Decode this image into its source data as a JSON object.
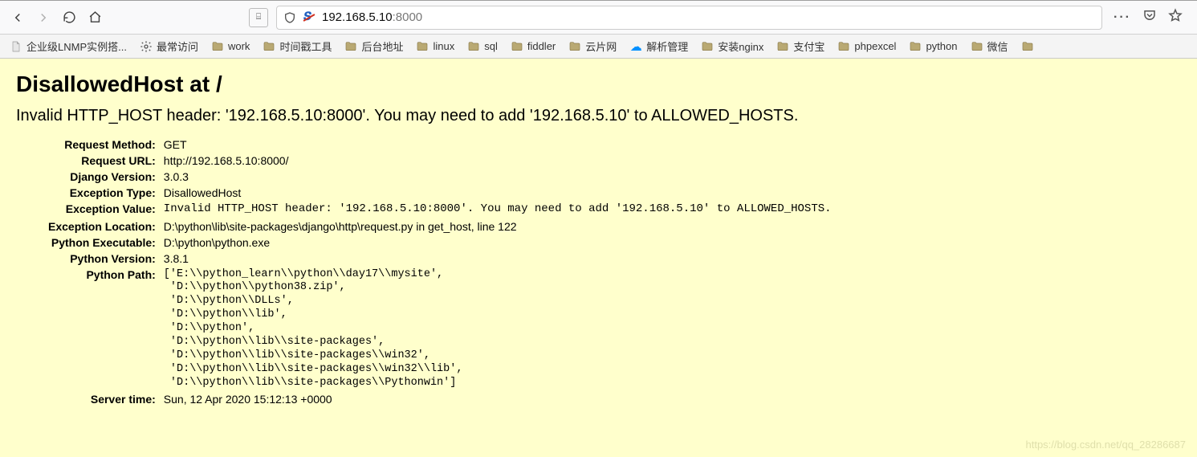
{
  "browser": {
    "url_host": "192.168.5.10",
    "url_port": ":8000"
  },
  "bookmarks": [
    {
      "type": "page",
      "label": "企业级LNMP实例搭...",
      "name": "bm-lnmp"
    },
    {
      "type": "gear",
      "label": "最常访问",
      "name": "bm-most-visited"
    },
    {
      "type": "folder",
      "label": "work",
      "name": "bm-work"
    },
    {
      "type": "folder",
      "label": "时间戳工具",
      "name": "bm-timestamp"
    },
    {
      "type": "folder",
      "label": "后台地址",
      "name": "bm-admin"
    },
    {
      "type": "folder",
      "label": "linux",
      "name": "bm-linux"
    },
    {
      "type": "folder",
      "label": "sql",
      "name": "bm-sql"
    },
    {
      "type": "folder",
      "label": "fiddler",
      "name": "bm-fiddler"
    },
    {
      "type": "folder",
      "label": "云片网",
      "name": "bm-yunpian"
    },
    {
      "type": "cloud",
      "label": "解析管理",
      "name": "bm-dns"
    },
    {
      "type": "folder",
      "label": "安装nginx",
      "name": "bm-nginx"
    },
    {
      "type": "folder",
      "label": "支付宝",
      "name": "bm-alipay"
    },
    {
      "type": "folder",
      "label": "phpexcel",
      "name": "bm-phpexcel"
    },
    {
      "type": "folder",
      "label": "python",
      "name": "bm-python"
    },
    {
      "type": "folder",
      "label": "微信",
      "name": "bm-wechat"
    },
    {
      "type": "folder",
      "label": "",
      "name": "bm-overflow"
    }
  ],
  "error": {
    "title": "DisallowedHost at /",
    "message": "Invalid HTTP_HOST header: '192.168.5.10:8000'. You may need to add '192.168.5.10' to ALLOWED_HOSTS.",
    "labels": {
      "request_method": "Request Method:",
      "request_url": "Request URL:",
      "django_version": "Django Version:",
      "exception_type": "Exception Type:",
      "exception_value": "Exception Value:",
      "exception_location": "Exception Location:",
      "python_executable": "Python Executable:",
      "python_version": "Python Version:",
      "python_path": "Python Path:",
      "server_time": "Server time:"
    },
    "request_method": "GET",
    "request_url": "http://192.168.5.10:8000/",
    "django_version": "3.0.3",
    "exception_type": "DisallowedHost",
    "exception_value": "Invalid HTTP_HOST header: '192.168.5.10:8000'. You may need to add '192.168.5.10' to ALLOWED_HOSTS.",
    "exception_location": "D:\\python\\lib\\site-packages\\django\\http\\request.py in get_host, line 122",
    "python_executable": "D:\\python\\python.exe",
    "python_version": "3.8.1",
    "python_path": "['E:\\\\python_learn\\\\python\\\\day17\\\\mysite',\n 'D:\\\\python\\\\python38.zip',\n 'D:\\\\python\\\\DLLs',\n 'D:\\\\python\\\\lib',\n 'D:\\\\python',\n 'D:\\\\python\\\\lib\\\\site-packages',\n 'D:\\\\python\\\\lib\\\\site-packages\\\\win32',\n 'D:\\\\python\\\\lib\\\\site-packages\\\\win32\\\\lib',\n 'D:\\\\python\\\\lib\\\\site-packages\\\\Pythonwin']",
    "server_time": "Sun, 12 Apr 2020 15:12:13 +0000"
  },
  "watermark": "https://blog.csdn.net/qq_28286687"
}
